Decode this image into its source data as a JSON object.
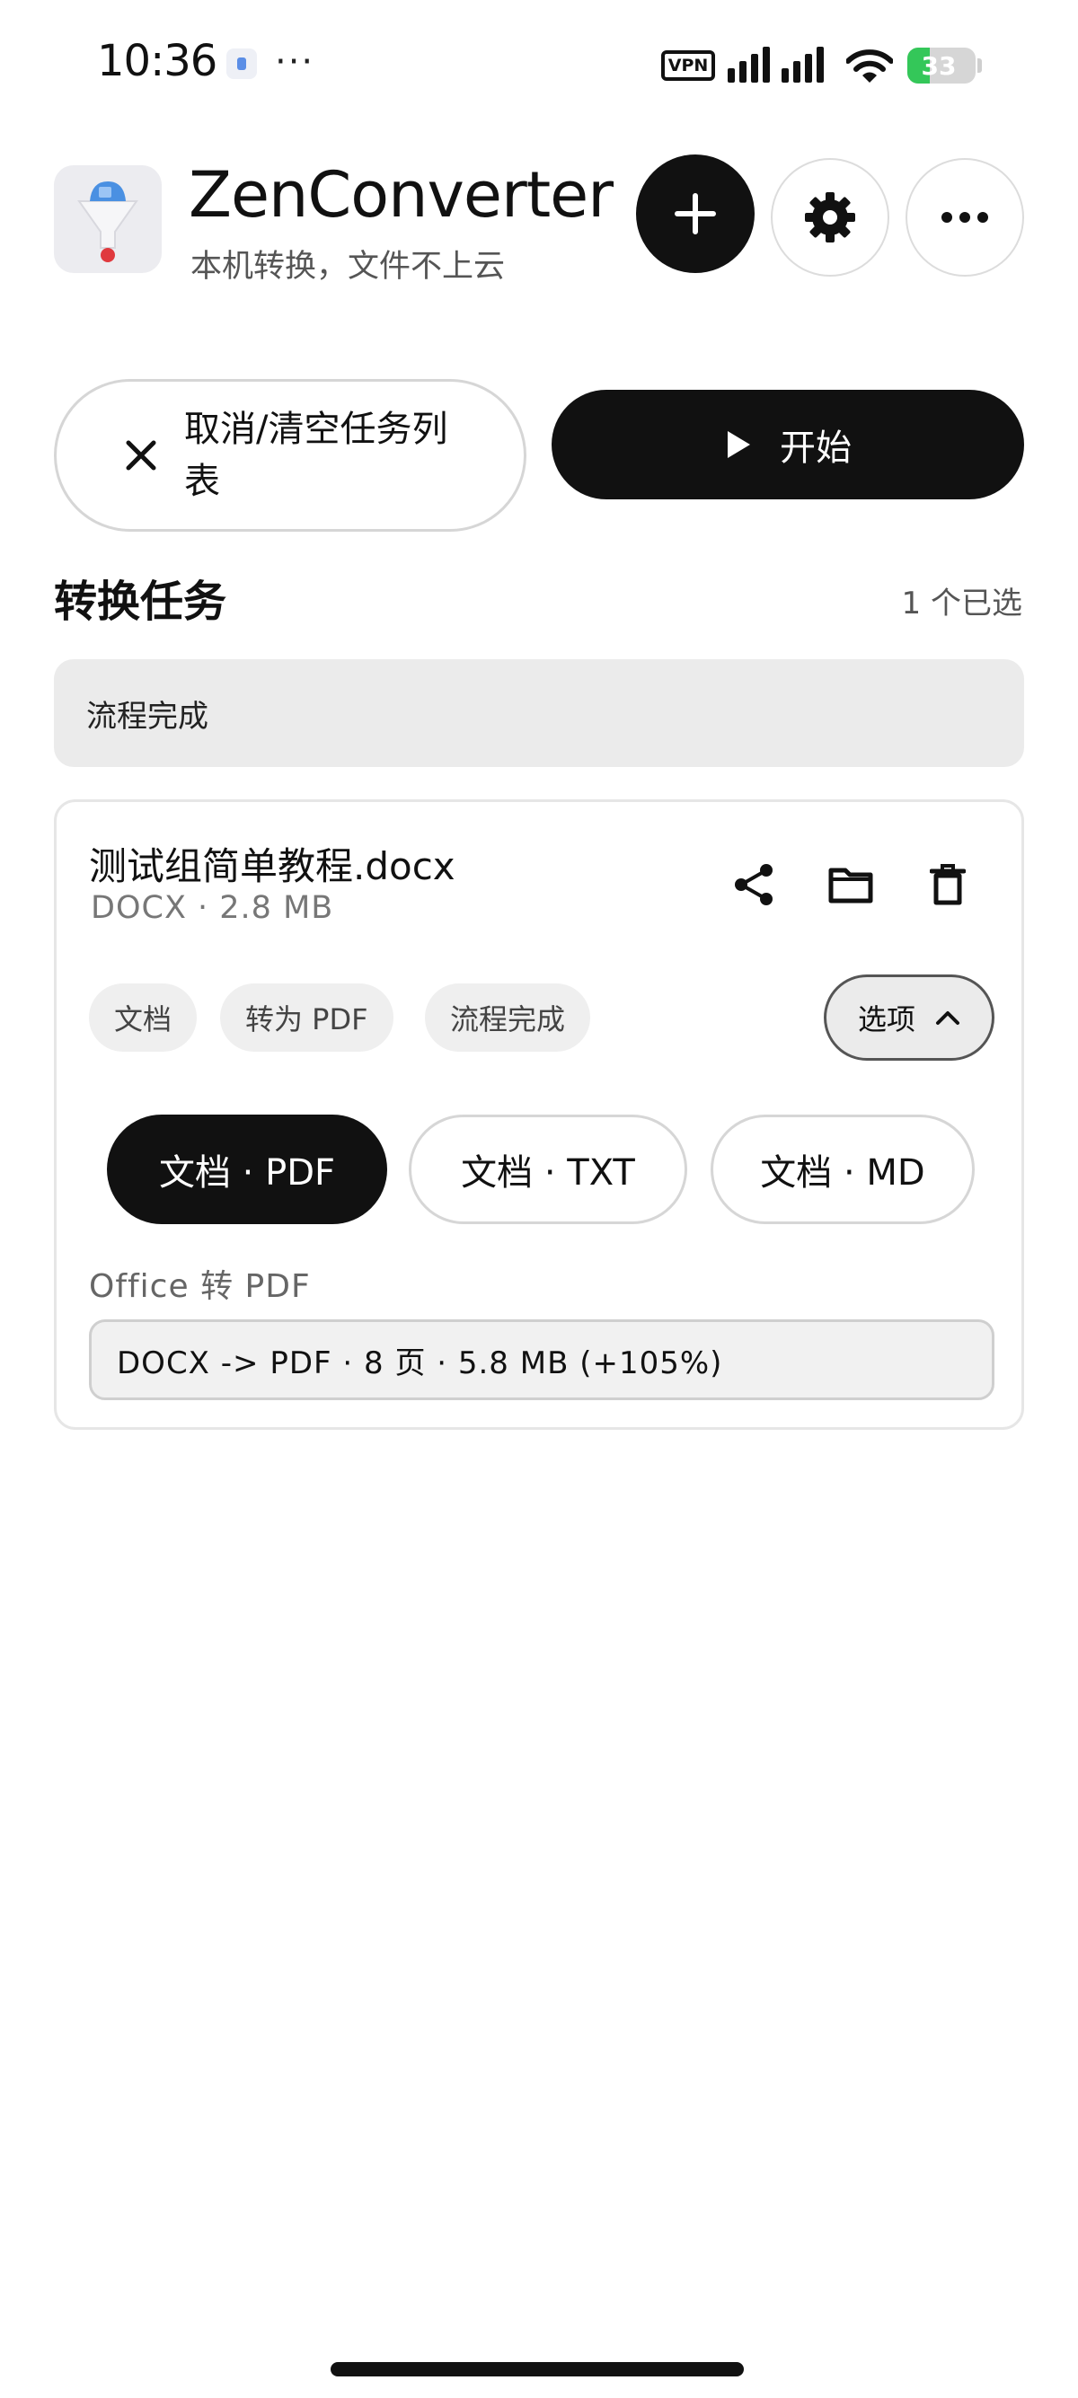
{
  "status_bar": {
    "time": "10:36",
    "dots": "···",
    "vpn": "VPN",
    "battery_level": "33",
    "battery_fraction": 0.33,
    "battery_color": "#34c759"
  },
  "header": {
    "title": "ZenConverter",
    "subtitle": "本机转换，文件不上云",
    "logo_icon": "funnel-icon",
    "add_icon": "plus-icon",
    "settings_icon": "gear-icon",
    "more_icon": "more-horizontal-icon"
  },
  "actions": {
    "cancel_label": "取消/清空任务列表",
    "cancel_icon": "close-icon",
    "start_label": "开始",
    "start_icon": "play-icon"
  },
  "section": {
    "title": "转换任务",
    "selected_count": "1 个已选"
  },
  "banner": {
    "text": "流程完成"
  },
  "task": {
    "file_name": "测试组简单教程.docx",
    "meta": "DOCX · 2.8 MB",
    "icons": [
      "share-icon",
      "folder-icon",
      "delete-icon"
    ],
    "chips": [
      "文档",
      "转为 PDF",
      "流程完成"
    ],
    "options_label": "选项",
    "options_icon": "chevron-up-icon",
    "formats": [
      "文档 · PDF",
      "文档 · TXT",
      "文档 · MD"
    ],
    "selected_format": "文档 · PDF",
    "engine": "Office 转 PDF",
    "result": "DOCX -> PDF · 8 页 · 5.8 MB (+105%)"
  }
}
